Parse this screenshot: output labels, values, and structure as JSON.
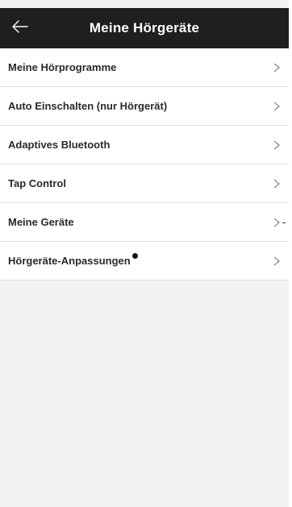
{
  "header": {
    "title": "Meine Hörgeräte",
    "back_icon": "arrow-left-icon"
  },
  "menu": {
    "items": [
      {
        "label": "Meine Hörprogramme",
        "icon": "chevron-right-icon"
      },
      {
        "label": "Auto Einschalten (nur Hörgerät)",
        "icon": "chevron-right-icon"
      },
      {
        "label": "Adaptives Bluetooth",
        "icon": "chevron-right-icon"
      },
      {
        "label": "Tap Control",
        "icon": "chevron-right-icon"
      },
      {
        "label": "Meine Geräte",
        "icon": "chevron-right-icon"
      },
      {
        "label": "Hörgeräte-Anpassungen",
        "icon": "chevron-right-icon",
        "has_notification_dot": true
      }
    ]
  },
  "colors": {
    "header_background": "#1f1f1f",
    "header_text": "#ffffff",
    "page_background": "#f2f2f2",
    "row_background": "#ffffff",
    "chevron": "#8a8a8a"
  }
}
